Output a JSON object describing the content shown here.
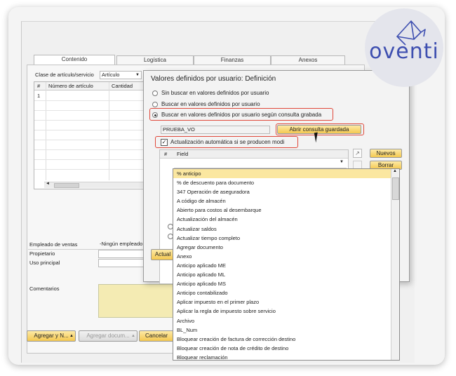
{
  "tabs": [
    "Contenido",
    "Logística",
    "Finanzas",
    "Anexos"
  ],
  "item_class": {
    "label": "Clase de artículo/servicio",
    "value": "Artículo"
  },
  "grid": {
    "headers": [
      "#",
      "Número de artículo",
      "Cantidad"
    ],
    "rows": [
      "1"
    ]
  },
  "footer_fields": {
    "sales_employee_label": "Empleado de ventas",
    "sales_employee_value": "-Ningún empleado",
    "owner_label": "Propietario",
    "main_use_label": "Uso principal",
    "comments_label": "Comentarios"
  },
  "buttons": {
    "add_and": "Agregar y N...",
    "add_doc": "Agregar docum...",
    "cancel": "Cancelar",
    "open_query": "Abrir consulta guardada",
    "new": "Nuevos",
    "delete": "Borrar",
    "update_partial": "Actual"
  },
  "dialog": {
    "title": "Valores definidos por usuario: Definición",
    "options": [
      "Sin buscar en valores definidos por usuario",
      "Buscar en valores definidos por usuario",
      "Buscar en valores definidos por usuario según consulta grabada"
    ],
    "selected_option": 2,
    "query_name": "PRUEBA_VO",
    "auto_update_label": "Actualización automática si se producen modi",
    "auto_update_checked": true,
    "field_grid_headers": [
      "#",
      "Field"
    ]
  },
  "dropdown_items": [
    "% anticipo",
    "% de descuento para documento",
    "347 Operación de aseguradora",
    "A código de almacén",
    "Abierto para costos al desembarque",
    "Actualización del almacén",
    "Actualizar saldos",
    "Actualizar tiempo completo",
    "Agregar documento",
    "Anexo",
    "Anticipo aplicado ME",
    "Anticipo aplicado ML",
    "Anticipo aplicado MS",
    "Anticipo contabilizado",
    "Aplicar impuesto en el primer plazo",
    "Aplicar la regla de impuesto sobre servicio",
    "Archivo",
    "BL_Num",
    "Bloquear creación de factura de corrección destino",
    "Bloquear creación de nota de crédito de destino",
    "Bloquear reclamación"
  ],
  "logo": {
    "text": "oventi",
    "color": "#3e4fb0"
  }
}
